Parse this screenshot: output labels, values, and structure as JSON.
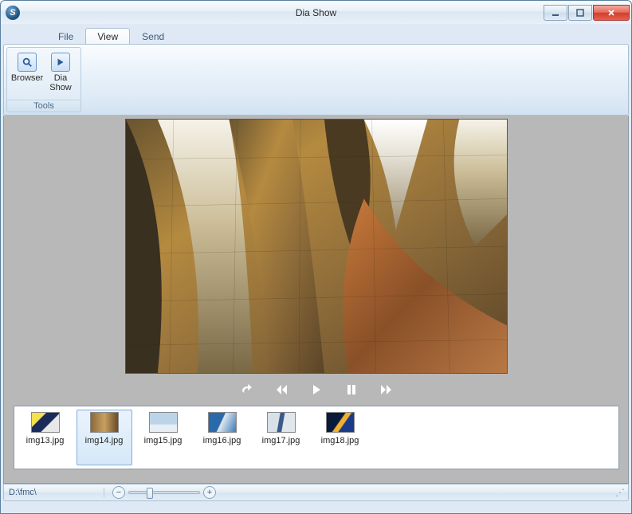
{
  "window": {
    "title": "Dia Show"
  },
  "menu": {
    "tabs": [
      {
        "label": "File"
      },
      {
        "label": "View"
      },
      {
        "label": "Send"
      }
    ],
    "active_index": 1
  },
  "ribbon": {
    "group_label": "Tools",
    "buttons": [
      {
        "label": "Browser",
        "icon": "magnifier-icon"
      },
      {
        "label": "Dia Show",
        "icon": "play-slide-icon"
      }
    ]
  },
  "playback": {
    "icons": [
      "share-icon",
      "rewind-icon",
      "play-icon",
      "pause-icon",
      "forward-icon"
    ]
  },
  "thumbnails": {
    "selected_index": 1,
    "items": [
      {
        "label": "img13.jpg"
      },
      {
        "label": "img14.jpg"
      },
      {
        "label": "img15.jpg"
      },
      {
        "label": "img16.jpg"
      },
      {
        "label": "img17.jpg"
      },
      {
        "label": "img18.jpg"
      }
    ]
  },
  "statusbar": {
    "path": "D:\\fmc\\",
    "zoom_minus": "−",
    "zoom_plus": "+"
  }
}
